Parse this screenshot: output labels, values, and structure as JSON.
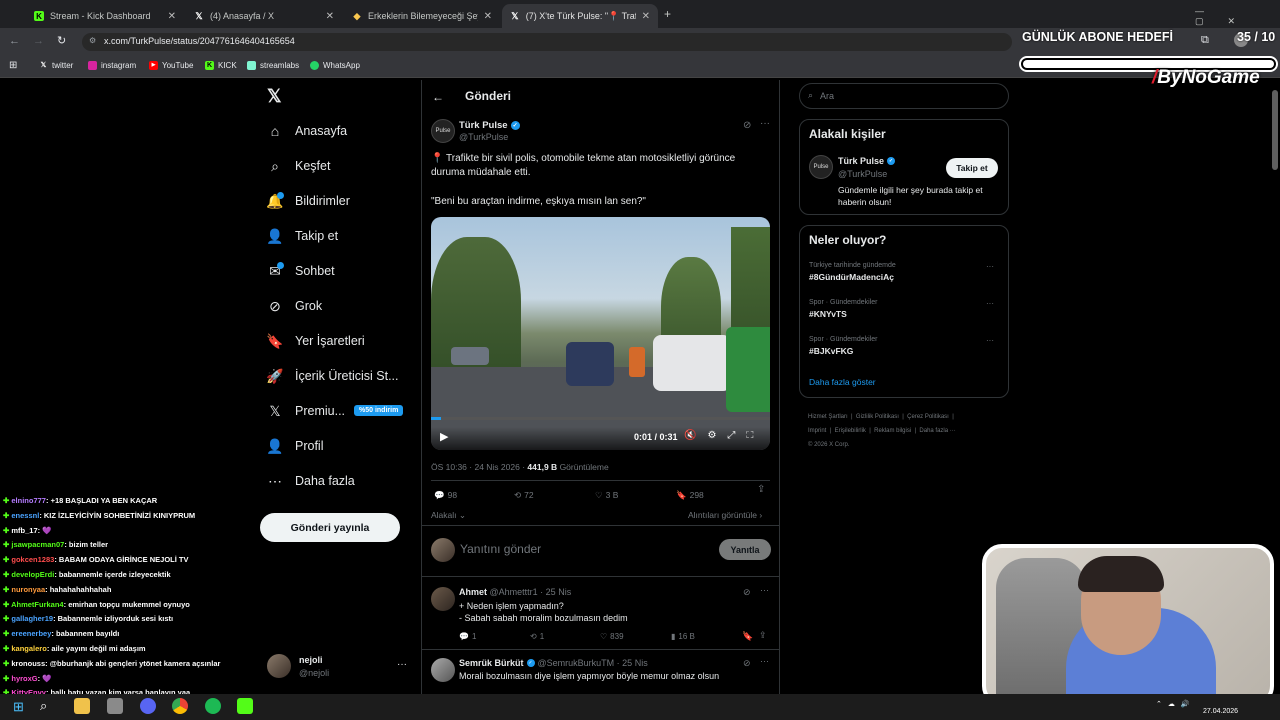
{
  "browser": {
    "tabs": [
      {
        "title": "Stream - Kick Dashboard"
      },
      {
        "title": "(4) Anasayfa / X"
      },
      {
        "title": "Erkeklerin Bilemeyeceği Şeyler"
      },
      {
        "title": "(7) X'te Türk Pulse: \"📍 Trafikte b"
      }
    ],
    "url": "x.com/TurkPulse/status/2047761646404165654",
    "bookmarks": [
      "twitter",
      "instagram",
      "YouTube",
      "KICK",
      "streamlabs",
      "WhatsApp"
    ]
  },
  "overlay": {
    "goal_label": "GÜNLÜK ABONE HEDEFİ",
    "goal_count": "35 / 10",
    "goal_progress": 1.0,
    "brand": "ByNoGame"
  },
  "sidebar": {
    "items": [
      {
        "label": "Anasayfa",
        "icon": "home-icon"
      },
      {
        "label": "Keşfet",
        "icon": "search-icon"
      },
      {
        "label": "Bildirimler",
        "icon": "bell-icon"
      },
      {
        "label": "Takip et",
        "icon": "follow-icon"
      },
      {
        "label": "Sohbet",
        "icon": "chat-icon"
      },
      {
        "label": "Grok",
        "icon": "grok-icon"
      },
      {
        "label": "Yer İşaretleri",
        "icon": "bookmark-icon"
      },
      {
        "label": "İçerik Üreticisi St...",
        "icon": "rocket-icon"
      },
      {
        "label": "Premiu...",
        "icon": "x-logo-icon"
      },
      {
        "label": "Profil",
        "icon": "user-icon"
      },
      {
        "label": "Daha fazla",
        "icon": "more-icon"
      }
    ],
    "premium_badge": "%50 indirim",
    "post_button": "Gönderi yayınla",
    "account": {
      "name": "nejoli",
      "handle": "@nejoli"
    }
  },
  "main": {
    "header": "Gönderi",
    "post": {
      "author": "Türk Pulse",
      "handle": "@TurkPulse",
      "text1": "📍 Trafikte bir sivil polis, otomobile tekme atan motosikletliyi görünce duruma müdahale etti.",
      "text2": "\"Beni bu araçtan indirme, eşkıya mısın lan sen?\"",
      "video_time": "0:01 / 0:31",
      "time": "ÖS 10:36 · 24 Nis 2026 ·",
      "views": "441,9 B",
      "views_label": "Görüntüleme",
      "stats": {
        "replies": "98",
        "reposts": "72",
        "likes": "3 B",
        "bookmarks": "298"
      },
      "relevant": "Alakalı",
      "quotes": "Alıntıları görüntüle"
    },
    "reply_box": {
      "placeholder": "Yanıtını gönder",
      "button": "Yanıtla"
    },
    "replies": [
      {
        "name": "Ahmet",
        "handle": "@Ahmetttr1 · 25 Nis",
        "line1": "+ Neden işlem yapmadın?",
        "line2": "- Sabah sabah moralim bozulmasın dedim",
        "replies": "1",
        "reposts": "1",
        "likes": "839",
        "views": "16 B"
      },
      {
        "name": "Semrük Bürküt",
        "handle": "@SemrukBurkuTM · 25 Nis",
        "line1": "Morali bozulmasın diye işlem yapmıyor böyle memur olmaz olsun"
      }
    ]
  },
  "right": {
    "search_placeholder": "Ara",
    "related_title": "Alakalı kişiler",
    "related": {
      "name": "Türk Pulse",
      "handle": "@TurkPulse",
      "bio": "Gündemle ilgili her şey burada takip et haberin olsun!",
      "follow": "Takip et"
    },
    "trends_title": "Neler oluyor?",
    "trends": [
      {
        "cat": "Türkiye tarihinde gündemde",
        "tag": "#8GündürMadenciAç"
      },
      {
        "cat": "Spor · Gündemdekiler",
        "tag": "#KNYvTS"
      },
      {
        "cat": "Spor · Gündemdekiler",
        "tag": "#BJKvFKG"
      }
    ],
    "show_more": "Daha fazla göster",
    "footer": [
      "Hizmet Şartları",
      "Gizlilik Politikası",
      "Çerez Politikası",
      "Imprint",
      "Erişilebilirlik",
      "Reklam bilgisi",
      "Daha fazla ···",
      "© 2026 X Corp."
    ]
  },
  "chat": [
    {
      "user": "elnino777",
      "color": "#b57cff",
      "msg": ": +18 BAŞLADI YA BEN KAÇAR"
    },
    {
      "user": "enessnl",
      "color": "#4aa3ff",
      "msg": ": KIZ İZLEYİCİYİN SOHBETİNİZİ KINIYPRUM"
    },
    {
      "user": "mfb_17",
      "color": "#ffffff",
      "msg": ": 💜"
    },
    {
      "user": "jsawpacman07",
      "color": "#53fc18",
      "msg": ": bizim teller"
    },
    {
      "user": "gokcen1283",
      "color": "#ff4d4d",
      "msg": ": BABAM ODAYA GİRİNCE NEJOLİ TV"
    },
    {
      "user": "developErdi",
      "color": "#53fc18",
      "msg": ": babannemle içerde izleyecektik"
    },
    {
      "user": "nuronyaa",
      "color": "#ff9a3c",
      "msg": ": hahahahahhahah"
    },
    {
      "user": "AhmetFurkan4",
      "color": "#53fc18",
      "msg": ": emirhan topçu mukemmel oynuyo"
    },
    {
      "user": "gallagher19",
      "color": "#4aa3ff",
      "msg": ": Babannemle izliyorduk sesi kıstı"
    },
    {
      "user": "ereenerbey",
      "color": "#4aa3ff",
      "msg": ": babannem bayıldı"
    },
    {
      "user": "kangalero",
      "color": "#ffd23c",
      "msg": ": aile yayını değil mi adaşım"
    },
    {
      "user": "kronouss",
      "color": "#ffffff",
      "msg": ": @bburhanjk abi gençleri ytönet kamera açsınlar"
    },
    {
      "user": "hyroxG",
      "color": "#ff4dd2",
      "msg": ": 💜"
    },
    {
      "user": "KittyEnvy",
      "color": "#ff4dd2",
      "msg": ": ballı batu yazan kim varsa banlayın yaa"
    }
  ],
  "taskbar": {
    "date": "27.04.2026"
  }
}
